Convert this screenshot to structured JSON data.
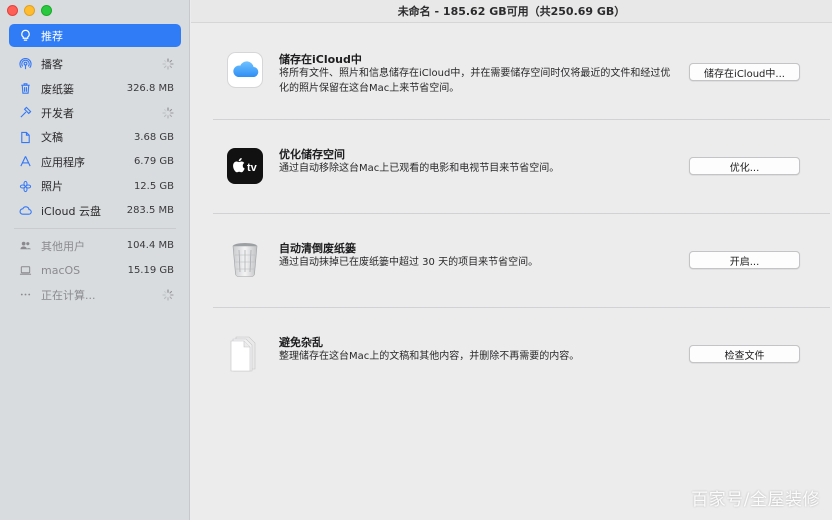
{
  "window": {
    "title": "未命名 - 185.62 GB可用（共250.69 GB）"
  },
  "sidebar": {
    "items": [
      {
        "label": "推荐",
        "size": "",
        "icon": "lightbulb-icon",
        "selected": true
      },
      {
        "label": "播客",
        "size": "",
        "icon": "podcast-icon",
        "loading": true
      },
      {
        "label": "废纸篓",
        "size": "326.8 MB",
        "icon": "trash-icon"
      },
      {
        "label": "开发者",
        "size": "",
        "icon": "hammer-icon",
        "loading": true
      },
      {
        "label": "文稿",
        "size": "3.68 GB",
        "icon": "document-icon"
      },
      {
        "label": "应用程序",
        "size": "6.79 GB",
        "icon": "apps-icon"
      },
      {
        "label": "照片",
        "size": "12.5 GB",
        "icon": "photos-icon"
      },
      {
        "label": "iCloud 云盘",
        "size": "283.5 MB",
        "icon": "cloud-icon"
      }
    ],
    "others": [
      {
        "label": "其他用户",
        "size": "104.4 MB",
        "icon": "users-icon"
      },
      {
        "label": "macOS",
        "size": "15.19 GB",
        "icon": "laptop-icon"
      },
      {
        "label": "正在计算...",
        "size": "",
        "icon": "ellipsis-icon",
        "loading": true
      }
    ]
  },
  "recommendations": [
    {
      "title": "储存在iCloud中",
      "desc": "将所有文件、照片和信息储存在iCloud中，并在需要储存空间时仅将最近的文件和经过优化的照片保留在这台Mac上来节省空间。",
      "button": "储存在iCloud中...",
      "icon": "icloud-icon"
    },
    {
      "title": "优化储存空间",
      "desc": "通过自动移除这台Mac上已观看的电影和电视节目来节省空间。",
      "button": "优化...",
      "icon": "apple-tv-icon"
    },
    {
      "title": "自动清倒废纸篓",
      "desc": "通过自动抹掉已在废纸篓中超过 30 天的项目来节省空间。",
      "button": "开启...",
      "icon": "trash-bin-icon"
    },
    {
      "title": "避免杂乱",
      "desc": "整理储存在这台Mac上的文稿和其他内容，并删除不再需要的内容。",
      "button": "检查文件",
      "icon": "document-stack-icon"
    }
  ],
  "watermark": "百家号/全屋装修",
  "colors": {
    "accent": "#2f7cf6",
    "sidebar_bg": "#d9dcdf",
    "main_bg": "#ececec"
  }
}
